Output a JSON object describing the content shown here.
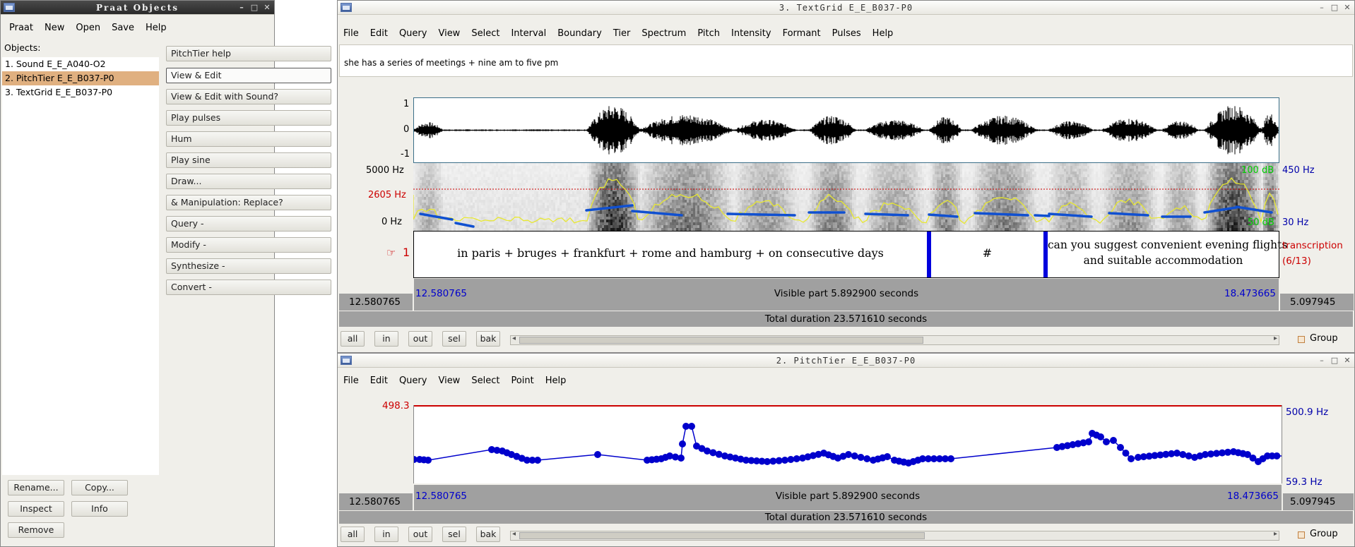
{
  "objects_window": {
    "title": "Praat Objects",
    "menu": [
      "Praat",
      "New",
      "Open",
      "Save",
      "Help"
    ],
    "objects_label": "Objects:",
    "items": [
      "1. Sound E_E_A040-O2",
      "2. PitchTier E_E_B037-P0",
      "3. TextGrid E_E_B037-P0"
    ],
    "actions": [
      "PitchTier help",
      "View & Edit",
      "View & Edit with Sound?",
      "Play pulses",
      "Hum",
      "Play sine",
      "Draw...",
      "& Manipulation: Replace?",
      "Query -",
      "Modify -",
      "Synthesize -",
      "Convert -"
    ],
    "bottom_buttons": [
      "Rename...",
      "Copy...",
      "Inspect",
      "Info",
      "Remove"
    ]
  },
  "textgrid_window": {
    "title": "3. TextGrid E_E_B037-P0",
    "menu": [
      "File",
      "Edit",
      "Query",
      "View",
      "Select",
      "Interval",
      "Boundary",
      "Tier",
      "Spectrum",
      "Pitch",
      "Intensity",
      "Formant",
      "Pulses",
      "Help"
    ],
    "text_field": "she has a series of meetings + nine am to five pm",
    "wave_ticks": [
      "1",
      "0",
      "-1"
    ],
    "spec_left": [
      "5000 Hz",
      "2605 Hz",
      "0 Hz"
    ],
    "spec_right_top_green": "100 dB",
    "spec_right_top_blue": "450 Hz",
    "spec_right_bottom_green": "50 dB",
    "spec_right_bottom_blue": "30 Hz",
    "tier_number": "1",
    "tier_name": "transcription",
    "tier_count": "(6/13)",
    "intervals": [
      "in paris + bruges + frankfurt + rome and hamburg + on consecutive days",
      "#",
      "can you suggest convenient evening flights",
      "and suitable accommodation"
    ],
    "left_time": "12.580765",
    "visible_start": "12.580765",
    "visible_part": "Visible part 5.892900 seconds",
    "visible_end": "18.473665",
    "right_time": "5.097945",
    "total": "Total duration 23.571610 seconds",
    "nav_buttons": [
      "all",
      "in",
      "out",
      "sel",
      "bak"
    ],
    "group": "Group"
  },
  "pitchtier_window": {
    "title": "2. PitchTier E_E_B037-P0",
    "menu": [
      "File",
      "Edit",
      "Query",
      "View",
      "Select",
      "Point",
      "Help"
    ],
    "top_value": "498.3",
    "right_top": "500.9 Hz",
    "right_bottom": "59.3 Hz",
    "left_time": "12.580765",
    "visible_start": "12.580765",
    "visible_part": "Visible part 5.892900 seconds",
    "visible_end": "18.473665",
    "right_time": "5.097945",
    "total": "Total duration 23.571610 seconds",
    "nav_buttons": [
      "all",
      "in",
      "out",
      "sel",
      "bak"
    ],
    "group": "Group"
  },
  "colors": {
    "selection": "#e0b080",
    "pitch_blue": "#0000cc",
    "cursor_red": "#cc0000",
    "db_green": "#00cc00",
    "boundary_blue": "#0000dd"
  }
}
